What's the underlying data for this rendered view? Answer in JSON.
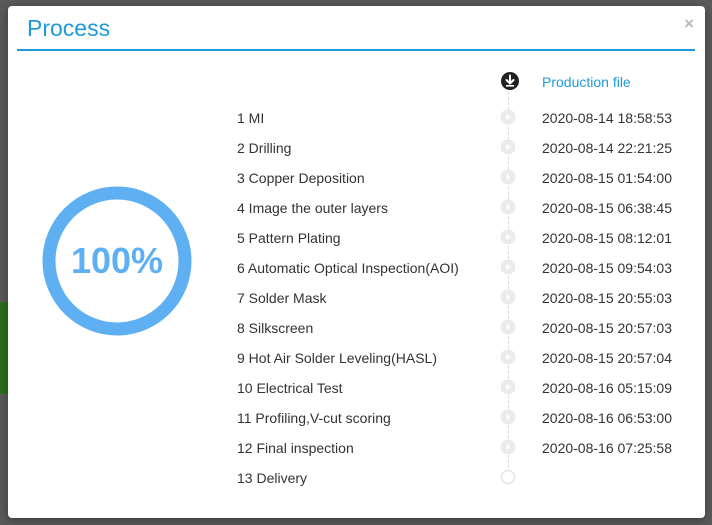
{
  "modal": {
    "title": "Process",
    "close_label": "×",
    "progress_text": "100%",
    "progress_fraction": 1.0,
    "column_header": "Production file",
    "header_icon": "download-circle-icon",
    "step_icon": "chevron-right-circle-icon"
  },
  "colors": {
    "accent": "#1e9bd7",
    "ring": "#5fb0f3",
    "dot": "#e6e6e6"
  },
  "steps": [
    {
      "label": "1  MI",
      "time": "2020-08-14 18:58:53",
      "state": "done"
    },
    {
      "label": "2  Drilling",
      "time": "2020-08-14 22:21:25",
      "state": "done"
    },
    {
      "label": "3  Copper Deposition",
      "time": "2020-08-15 01:54:00",
      "state": "done"
    },
    {
      "label": "4  Image the outer layers",
      "time": "2020-08-15 06:38:45",
      "state": "done"
    },
    {
      "label": "5  Pattern Plating",
      "time": "2020-08-15 08:12:01",
      "state": "done"
    },
    {
      "label": "6  Automatic Optical Inspection(AOI)",
      "time": "2020-08-15 09:54:03",
      "state": "done"
    },
    {
      "label": "7  Solder Mask",
      "time": "2020-08-15 20:55:03",
      "state": "done"
    },
    {
      "label": "8  Silkscreen",
      "time": "2020-08-15 20:57:03",
      "state": "done"
    },
    {
      "label": "9  Hot Air Solder Leveling(HASL)",
      "time": "2020-08-15 20:57:04",
      "state": "done"
    },
    {
      "label": "10  Electrical Test",
      "time": "2020-08-16 05:15:09",
      "state": "done"
    },
    {
      "label": "11  Profiling,V-cut scoring",
      "time": "2020-08-16 06:53:00",
      "state": "done"
    },
    {
      "label": "12  Final inspection",
      "time": "2020-08-16 07:25:58",
      "state": "done"
    },
    {
      "label": "13  Delivery",
      "time": "",
      "state": "pending"
    }
  ]
}
